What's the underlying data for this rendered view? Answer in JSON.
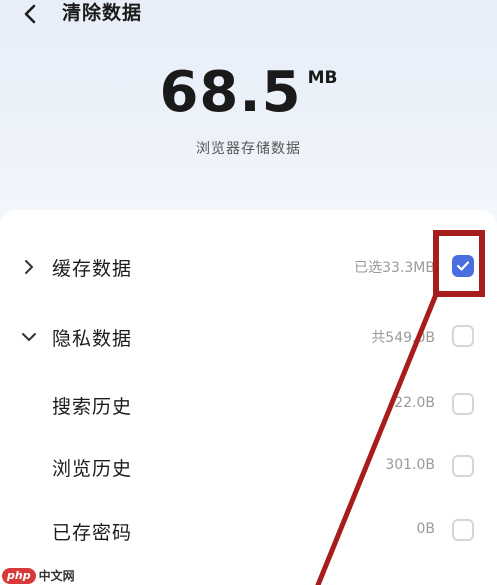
{
  "header": {
    "title": "清除数据",
    "back_icon": "chevron-left-icon"
  },
  "summary": {
    "value": "68.5",
    "unit": "MB",
    "caption": "浏览器存储数据"
  },
  "items": [
    {
      "label": "缓存数据",
      "amount": "已选33.3MB",
      "checked": true,
      "expander": "chevron-right-icon"
    },
    {
      "label": "隐私数据",
      "amount": "共549.0B",
      "checked": false,
      "expander": "chevron-down-icon"
    },
    {
      "label": "搜索历史",
      "amount": "22.0B",
      "checked": false
    },
    {
      "label": "浏览历史",
      "amount": "301.0B",
      "checked": false
    },
    {
      "label": "已存密码",
      "amount": "0B",
      "checked": false
    }
  ],
  "colors": {
    "accent": "#4a6ee0",
    "annotation": "#a71c1c"
  },
  "watermark": {
    "logo": "php",
    "text": "中文网"
  }
}
